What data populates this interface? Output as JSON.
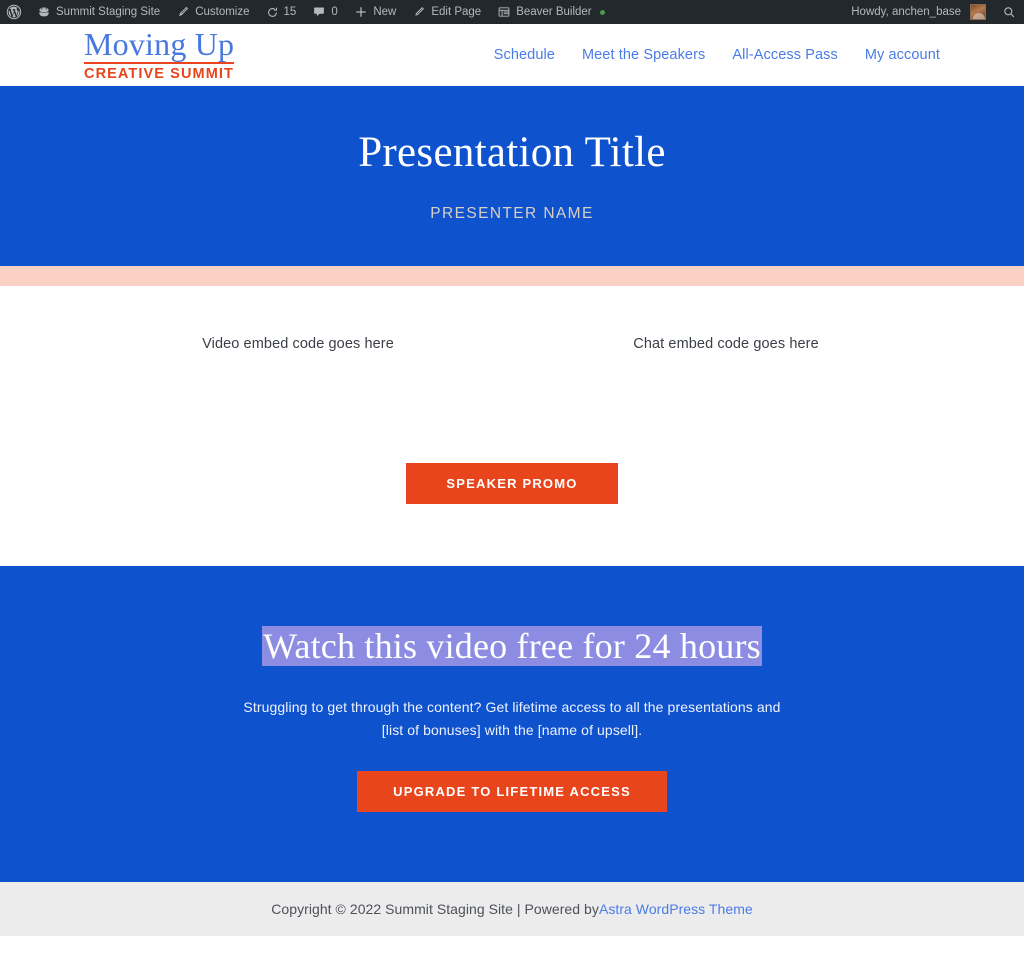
{
  "adminbar": {
    "wp_logo_icon": "wordpress-logo-icon",
    "site_icon": "home-dashboard-icon",
    "site_name": "Summit Staging Site",
    "customize_icon": "paintbrush-icon",
    "customize_label": "Customize",
    "updates_icon": "updates-refresh-icon",
    "updates_count": "15",
    "comments_icon": "comment-bubble-icon",
    "comments_count": "0",
    "new_icon": "plus-icon",
    "new_label": "New",
    "edit_icon": "pencil-edit-icon",
    "edit_label": "Edit Page",
    "builder_icon": "beaver-builder-layout-icon",
    "builder_label": "Beaver Builder",
    "howdy": "Howdy, anchen_base",
    "avatar_name": "user-avatar",
    "search_icon": "search-icon"
  },
  "header": {
    "logo_top": "Moving Up",
    "logo_bottom": "CREATIVE SUMMIT",
    "nav": [
      {
        "label": "Schedule"
      },
      {
        "label": "Meet the Speakers"
      },
      {
        "label": "All-Access Pass"
      },
      {
        "label": "My account"
      }
    ]
  },
  "hero": {
    "title": "Presentation Title",
    "presenter": "PRESENTER NAME"
  },
  "main": {
    "video_placeholder": "Video embed code goes here",
    "chat_placeholder": "Chat embed code goes here",
    "promo_button": "SPEAKER PROMO"
  },
  "cta": {
    "title": "Watch this video free for 24 hours",
    "body": "Struggling to get through the content? Get lifetime access to all the presentations and [list of bonuses] with the [name of upsell].",
    "button": "UPGRADE TO LIFETIME ACCESS"
  },
  "footer": {
    "text": "Copyright © 2022 Summit Staging Site | Powered by ",
    "link": "Astra WordPress Theme"
  },
  "colors": {
    "brand_blue": "#0F52CE",
    "brand_orange": "#E8451C",
    "link_blue": "#4a7ce8",
    "peach": "#FBD0C4",
    "highlight": "#8C8CE3",
    "adminbar": "#23282d",
    "footer_bg": "#ECECEC"
  }
}
